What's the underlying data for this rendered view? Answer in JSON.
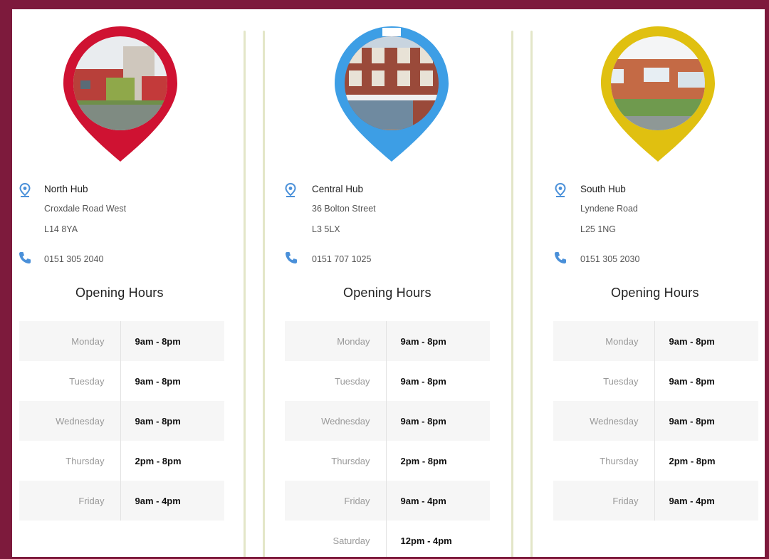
{
  "hubs": [
    {
      "name": "North Hub",
      "address_line1": "Croxdale Road West",
      "postcode": "L14 8YA",
      "phone": "0151 305 2040",
      "pin_color": "#cf1232",
      "photo_icon": "building-photo",
      "hours_title": "Opening Hours",
      "hours": [
        {
          "day": "Monday",
          "time": "9am - 8pm"
        },
        {
          "day": "Tuesday",
          "time": "9am - 8pm"
        },
        {
          "day": "Wednesday",
          "time": "9am - 8pm"
        },
        {
          "day": "Thursday",
          "time": "2pm - 8pm"
        },
        {
          "day": "Friday",
          "time": "9am - 4pm"
        }
      ]
    },
    {
      "name": "Central Hub",
      "address_line1": "36 Bolton Street",
      "postcode": "L3 5LX",
      "phone": "0151 707 1025",
      "pin_color": "#3d9ee5",
      "photo_icon": "building-photo",
      "hours_title": "Opening Hours",
      "hours": [
        {
          "day": "Monday",
          "time": "9am - 8pm"
        },
        {
          "day": "Tuesday",
          "time": "9am - 8pm"
        },
        {
          "day": "Wednesday",
          "time": "9am - 8pm"
        },
        {
          "day": "Thursday",
          "time": "2pm - 8pm"
        },
        {
          "day": "Friday",
          "time": "9am - 4pm"
        },
        {
          "day": "Saturday",
          "time": "12pm - 4pm"
        }
      ]
    },
    {
      "name": "South Hub",
      "address_line1": "Lyndene Road",
      "postcode": "L25 1NG",
      "phone": "0151 305 2030",
      "pin_color": "#e0c010",
      "photo_icon": "building-photo",
      "hours_title": "Opening Hours",
      "hours": [
        {
          "day": "Monday",
          "time": "9am - 8pm"
        },
        {
          "day": "Tuesday",
          "time": "9am - 8pm"
        },
        {
          "day": "Wednesday",
          "time": "9am - 8pm"
        },
        {
          "day": "Thursday",
          "time": "2pm - 8pm"
        },
        {
          "day": "Friday",
          "time": "9am - 4pm"
        }
      ]
    }
  ],
  "colors": {
    "page_border": "#7d1a3c",
    "location_icon": "#4a90d9",
    "phone_icon": "#4a90d9",
    "divider": "#e3e6c8"
  },
  "icons": {
    "location": "location-pin-icon",
    "phone": "phone-icon"
  }
}
